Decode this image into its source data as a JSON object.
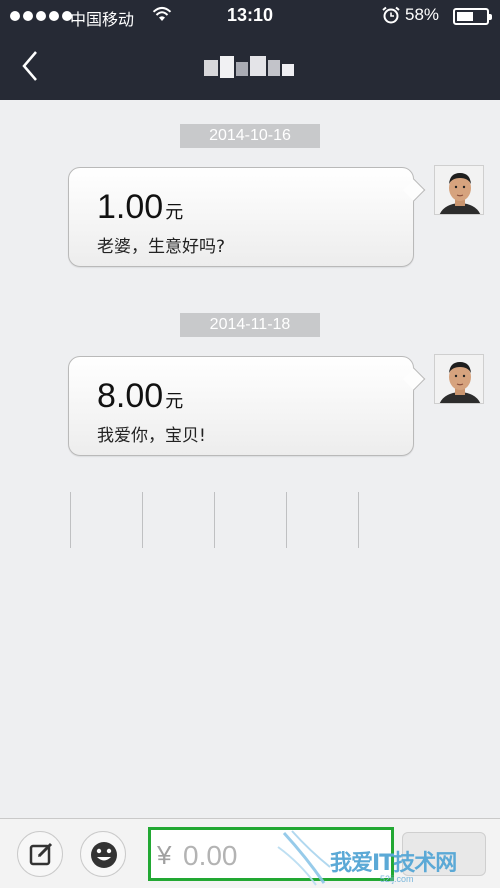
{
  "status_bar": {
    "carrier": "中国移动",
    "time": "13:10",
    "battery_percent": "58%",
    "battery_level": 0.58,
    "icons": [
      "signal-dots-icon",
      "wifi-icon",
      "alarm-icon",
      "battery-icon"
    ]
  },
  "nav": {
    "back_icon": "chevron-left-icon",
    "title_redacted": true
  },
  "messages": [
    {
      "date": "2014-10-16",
      "amount": "1.00",
      "unit": "元",
      "note": "老婆，生意好吗?"
    },
    {
      "date": "2014-11-18",
      "amount": "8.00",
      "unit": "元",
      "note": "我爱你，宝贝!"
    }
  ],
  "input_bar": {
    "compose_icon": "compose-icon",
    "emoji_icon": "smiley-icon",
    "currency_symbol": "¥",
    "amount_placeholder": "0.00",
    "input_border_color": "#22a833"
  },
  "watermark": {
    "text": "我爱IT技术网",
    "url": "52ij.com"
  },
  "colors": {
    "header_bg": "#262a35",
    "chat_bg": "#eeeff1",
    "date_badge_bg": "#c8c9cb"
  }
}
